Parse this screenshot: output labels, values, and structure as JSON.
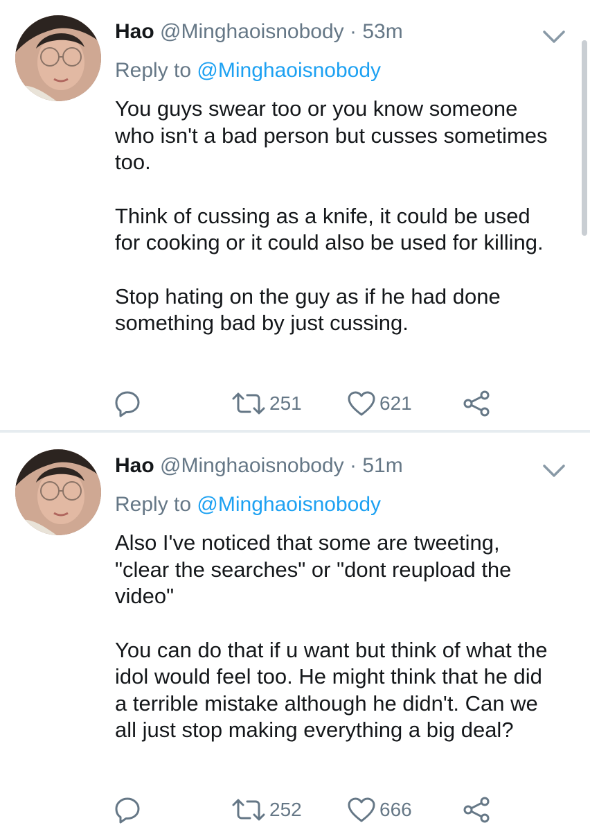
{
  "tweets": [
    {
      "name": "Hao",
      "handle": "@Minghaoisnobody",
      "separator": "·",
      "time": "53m",
      "reply_prefix": "Reply to",
      "reply_to": "@Minghaoisnobody",
      "paragraphs": [
        "You guys swear too or you know someone who isn't a bad person but cusses sometimes too.",
        "Think of cussing as a knife, it could be used for cooking or it could also be used for killing.",
        "Stop hating on the guy as if he had done something bad by just cussing."
      ],
      "retweets": "251",
      "likes": "621"
    },
    {
      "name": "Hao",
      "handle": "@Minghaoisnobody",
      "separator": "·",
      "time": "51m",
      "reply_prefix": "Reply to",
      "reply_to": "@Minghaoisnobody",
      "paragraphs": [
        "Also I've noticed that some are tweeting, \"clear the searches\" or \"dont reupload the video\"",
        "You can do that if u want but think of what the idol would feel too. He might think that he did a terrible mistake although he didn't. Can we all just stop making everything a big deal?"
      ],
      "retweets": "252",
      "likes": "666"
    }
  ],
  "icons": {
    "reply": "reply-icon",
    "retweet": "retweet-icon",
    "like": "heart-icon",
    "share": "share-icon",
    "menu": "chevron-down-icon"
  },
  "colors": {
    "text": "#14171a",
    "secondary": "#657786",
    "link": "#1da1f2",
    "divider": "#e6ecf0"
  }
}
